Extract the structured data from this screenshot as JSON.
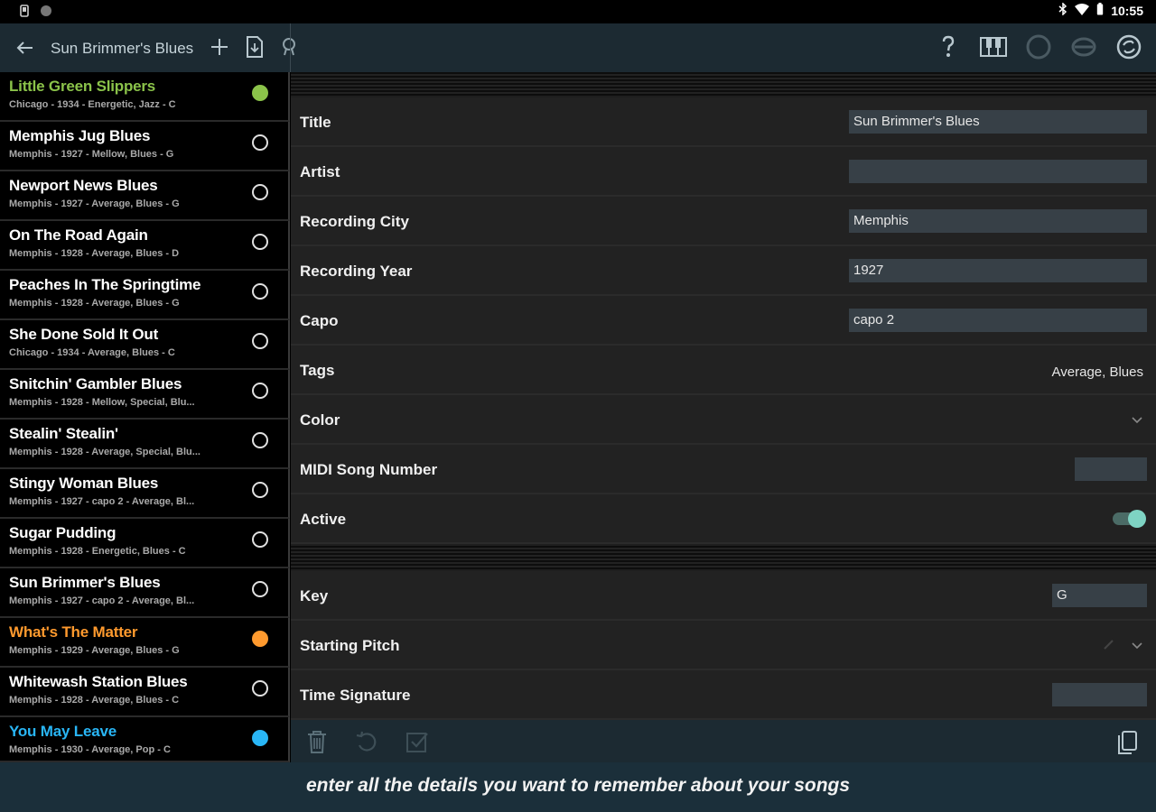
{
  "status": {
    "time": "10:55"
  },
  "appbar": {
    "title": "Sun Brimmer's Blues"
  },
  "colors": {
    "green": "#8bc34a",
    "orange": "#ff9a2e",
    "blue": "#29b6f6",
    "accent_teal": "#7ed3c3"
  },
  "songs": [
    {
      "name": "Little Green Slippers",
      "meta": "Chicago - 1934 - Energetic, Jazz - C",
      "color": "#8bc34a",
      "state": "filled"
    },
    {
      "name": "Memphis Jug Blues",
      "meta": "Memphis - 1927 - Mellow, Blues - G",
      "color": "#ffffff",
      "state": "empty"
    },
    {
      "name": "Newport News Blues",
      "meta": "Memphis - 1927 - Average, Blues - G",
      "color": "#ffffff",
      "state": "empty"
    },
    {
      "name": "On The Road Again",
      "meta": "Memphis - 1928 - Average, Blues - D",
      "color": "#ffffff",
      "state": "empty"
    },
    {
      "name": "Peaches In The Springtime",
      "meta": "Memphis - 1928 - Average, Blues - G",
      "color": "#ffffff",
      "state": "empty"
    },
    {
      "name": "She Done Sold It Out",
      "meta": "Chicago - 1934 - Average, Blues - C",
      "color": "#ffffff",
      "state": "empty"
    },
    {
      "name": "Snitchin' Gambler Blues",
      "meta": "Memphis - 1928 - Mellow, Special, Blu...",
      "color": "#ffffff",
      "state": "empty"
    },
    {
      "name": "Stealin' Stealin'",
      "meta": "Memphis - 1928 - Average, Special, Blu...",
      "color": "#ffffff",
      "state": "empty"
    },
    {
      "name": "Stingy Woman Blues",
      "meta": "Memphis - 1927 - capo 2 - Average, Bl...",
      "color": "#ffffff",
      "state": "empty"
    },
    {
      "name": "Sugar Pudding",
      "meta": "Memphis - 1928 - Energetic, Blues - C",
      "color": "#ffffff",
      "state": "empty"
    },
    {
      "name": "Sun Brimmer's Blues",
      "meta": "Memphis - 1927 - capo 2 - Average, Bl...",
      "color": "#ffffff",
      "state": "empty"
    },
    {
      "name": "What's The Matter",
      "meta": "Memphis - 1929 - Average, Blues - G",
      "color": "#ff9a2e",
      "state": "filled"
    },
    {
      "name": "Whitewash Station Blues",
      "meta": "Memphis - 1928 - Average, Blues - C",
      "color": "#ffffff",
      "state": "empty"
    },
    {
      "name": "You May Leave",
      "meta": "Memphis - 1930 - Average, Pop - C",
      "color": "#29b6f6",
      "state": "filled"
    }
  ],
  "details": {
    "title_label": "Title",
    "title_value": "Sun Brimmer's Blues",
    "artist_label": "Artist",
    "artist_value": "",
    "city_label": "Recording City",
    "city_value": "Memphis",
    "year_label": "Recording Year",
    "year_value": "1927",
    "capo_label": "Capo",
    "capo_value": "capo 2",
    "tags_label": "Tags",
    "tags_value": "Average, Blues",
    "color_label": "Color",
    "midi_label": "MIDI Song Number",
    "midi_value": "",
    "active_label": "Active",
    "active_on": true,
    "key_label": "Key",
    "key_value": "G",
    "pitch_label": "Starting Pitch",
    "timesig_label": "Time Signature",
    "timesig_value": ""
  },
  "caption": {
    "text": "enter all the details you want to remember about your songs"
  }
}
